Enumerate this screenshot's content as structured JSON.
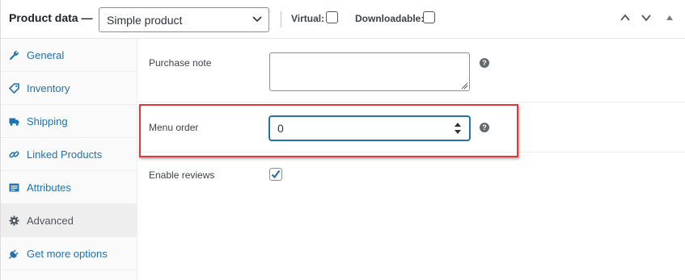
{
  "header": {
    "title": "Product data —",
    "product_type": "Simple product",
    "virtual_label": "Virtual:",
    "downloadable_label": "Downloadable:",
    "virtual_checked": false,
    "downloadable_checked": false
  },
  "tabs": [
    {
      "label": "General",
      "icon": "wrench-icon"
    },
    {
      "label": "Inventory",
      "icon": "tag-icon"
    },
    {
      "label": "Shipping",
      "icon": "truck-icon"
    },
    {
      "label": "Linked Products",
      "icon": "link-icon"
    },
    {
      "label": "Attributes",
      "icon": "list-icon"
    },
    {
      "label": "Advanced",
      "icon": "gear-icon",
      "active": true
    },
    {
      "label": "Get more options",
      "icon": "plug-icon"
    }
  ],
  "fields": {
    "purchase_note": {
      "label": "Purchase note",
      "value": ""
    },
    "menu_order": {
      "label": "Menu order",
      "value": "0"
    },
    "enable_reviews": {
      "label": "Enable reviews",
      "checked": true
    }
  },
  "help_glyph": "?",
  "colors": {
    "link": "#2271b1",
    "highlight": "#e2373f",
    "focus": "#2271b1"
  }
}
